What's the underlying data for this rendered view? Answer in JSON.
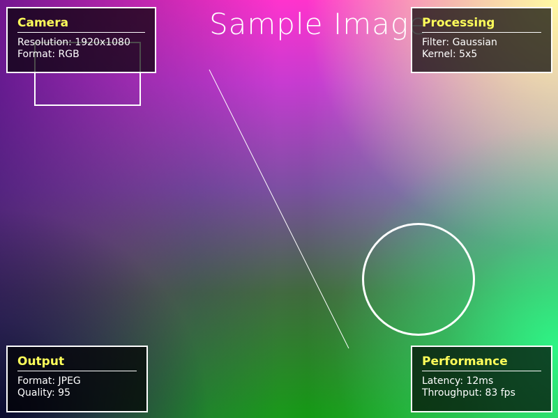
{
  "title": "Sample Image",
  "colors": {
    "panel_title": "#ffff5a",
    "panel_text": "#ffffff",
    "panel_border": "#ffffff"
  },
  "panels": {
    "camera": {
      "title": "Camera",
      "lines": [
        "Resolution: 1920x1080",
        "Format: RGB"
      ]
    },
    "processing": {
      "title": "Processing",
      "lines": [
        "Filter: Gaussian",
        "Kernel: 5x5"
      ]
    },
    "output": {
      "title": "Output",
      "lines": [
        "Format: JPEG",
        "Quality: 95"
      ]
    },
    "performance": {
      "title": "Performance",
      "lines": [
        "Latency: 12ms",
        "Throughput: 83 fps"
      ]
    }
  }
}
